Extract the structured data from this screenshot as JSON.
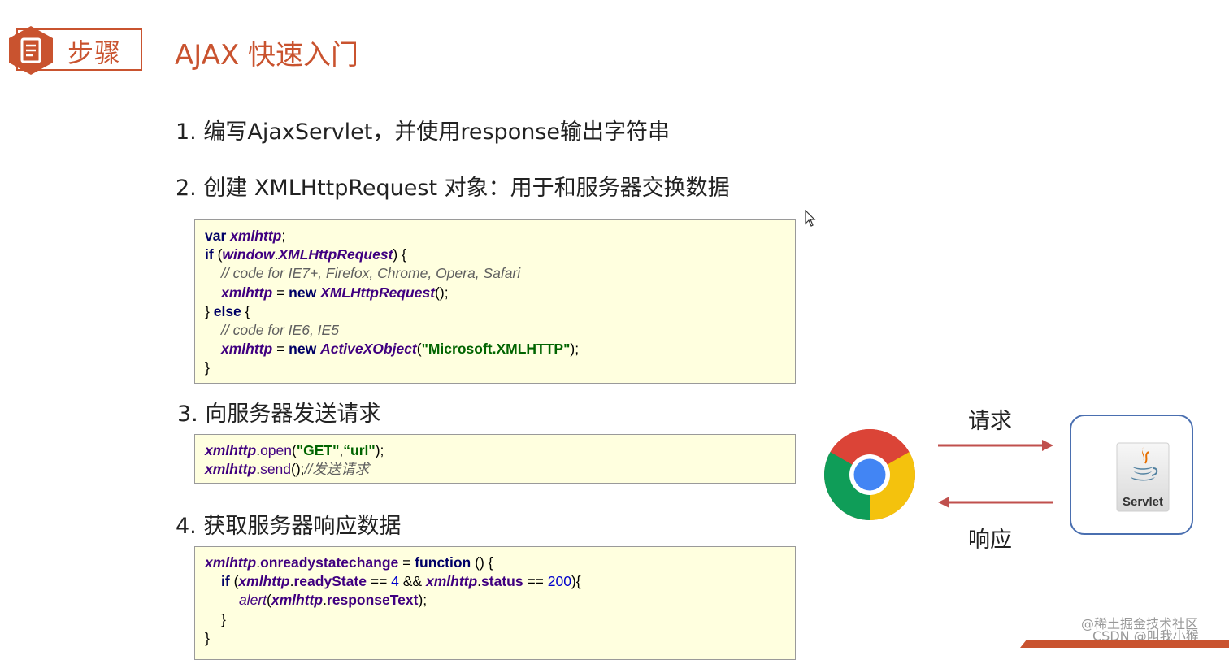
{
  "header": {
    "badge_label": "步骤",
    "title": "AJAX 快速入门"
  },
  "steps": [
    {
      "label": "1. 编写AjaxServlet，并使用response输出字符串"
    },
    {
      "label": "2. 创建 XMLHttpRequest 对象：用于和服务器交换数据"
    },
    {
      "label": "3. 向服务器发送请求"
    },
    {
      "label": "4. 获取服务器响应数据"
    }
  ],
  "code_create": [
    "var xmlhttp;",
    "if (window.XMLHttpRequest) {",
    "// code for IE7+, Firefox, Chrome, Opera, Safari",
    "xmlhttp = new XMLHttpRequest();",
    "} else {",
    "// code for IE6, IE5",
    "xmlhttp = new ActiveXObject(\"Microsoft.XMLHTTP\");",
    "}"
  ],
  "code_send": [
    "xmlhttp.open(\"GET\",“url\");",
    "xmlhttp.send();//发送请求"
  ],
  "code_response": [
    "xmlhttp.onreadystatechange = function () {",
    "if (xmlhttp.readyState == 4 && xmlhttp.status == 200){",
    "alert(xmlhttp.responseText);",
    "}",
    "}"
  ],
  "diagram": {
    "request_label": "请求",
    "response_label": "响应",
    "servlet_label": "Servlet",
    "arrow_color": "#c0504d",
    "box_border_color": "#4a6fb0"
  },
  "watermark": {
    "line1": "@稀土掘金技术社区",
    "line2": "CSDN @叫我小猴"
  },
  "colors": {
    "accent": "#c9532f",
    "code_background": "#ffffdf"
  }
}
